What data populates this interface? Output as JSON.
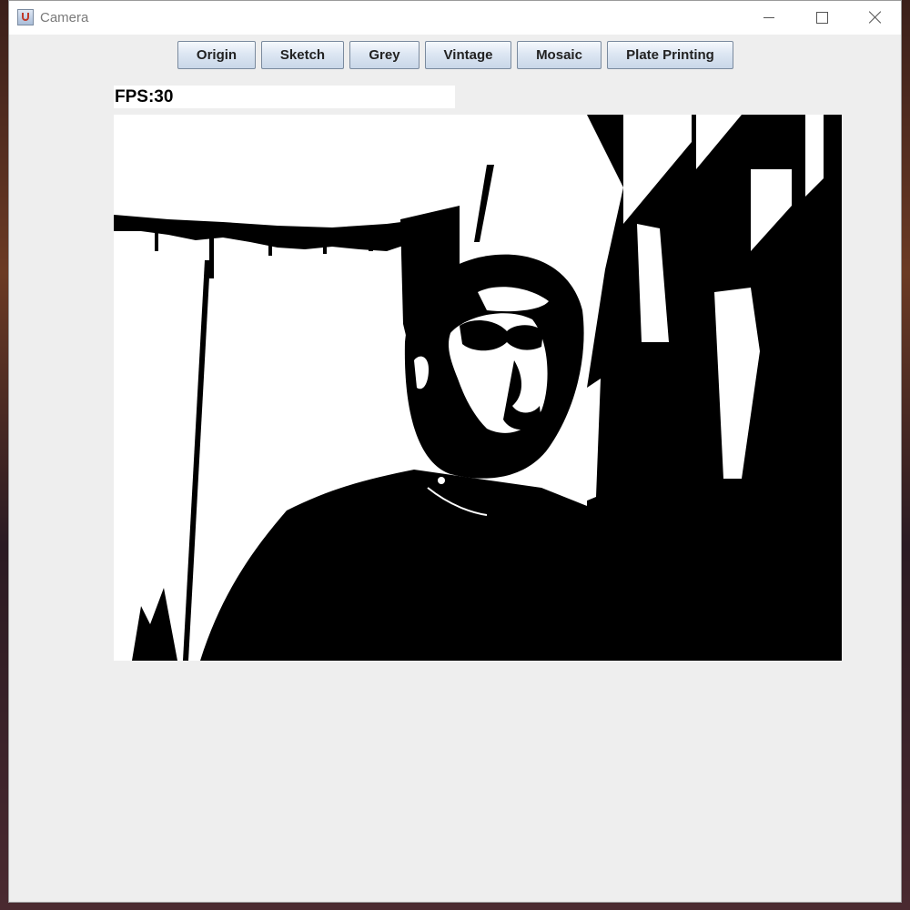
{
  "window": {
    "title": "Camera",
    "minimize_glyph": "",
    "maximize_glyph": "",
    "close_glyph": ""
  },
  "toolbar": {
    "buttons": [
      {
        "label": "Origin"
      },
      {
        "label": "Sketch"
      },
      {
        "label": "Grey"
      },
      {
        "label": "Vintage"
      },
      {
        "label": "Mosaic"
      },
      {
        "label": "Plate Printing"
      }
    ]
  },
  "status": {
    "fps_text": "FPS:30"
  },
  "camera": {
    "mode": "Plate Printing",
    "colors": {
      "ink": "#000000",
      "paper": "#ffffff"
    }
  },
  "icons": {
    "app": "java-cup-icon",
    "minimize": "minimize-icon",
    "maximize": "maximize-icon",
    "close": "close-icon"
  }
}
